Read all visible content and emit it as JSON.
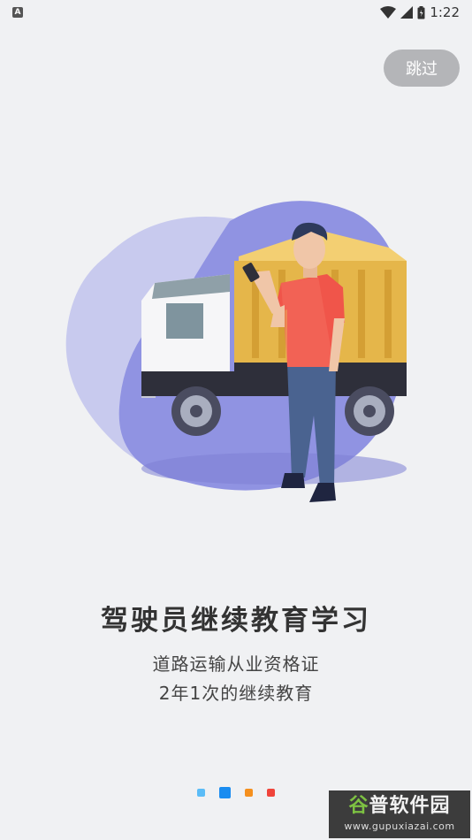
{
  "status_bar": {
    "notification_badge": "A",
    "time": "1:22",
    "icons": [
      "wifi-icon",
      "signal-icon",
      "battery-icon"
    ]
  },
  "skip_button": {
    "label": "跳过"
  },
  "illustration": {
    "subject": "truck-driver-illustration",
    "colors": {
      "blob_light": "#c3c5ec",
      "blob_dark": "#8c8fe0",
      "truck_bed": "#e5b64a",
      "shirt": "#f0554a",
      "pants": "#4a6390"
    }
  },
  "content": {
    "title": "驾驶员继续教育学习",
    "subtitle_line1": "道路运输从业资格证",
    "subtitle_line2": "2年1次的继续教育"
  },
  "pager": {
    "current_index": 1,
    "dots": [
      {
        "color": "#5bbcf7"
      },
      {
        "color": "#1a8cf0"
      },
      {
        "color": "#f5901e"
      },
      {
        "color": "#f0443a"
      }
    ]
  },
  "watermark": {
    "logo_part1": "谷",
    "logo_part2": "普软件园",
    "url": "www.gupuxiazai.com"
  }
}
